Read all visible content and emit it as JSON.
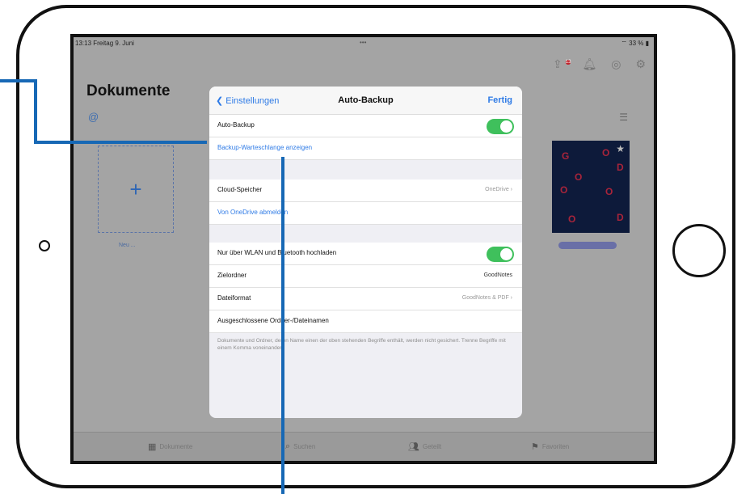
{
  "status": {
    "time": "13:13  Freitag 9. Juni",
    "dots": "•••",
    "battery": "⌔ 33 % ▮"
  },
  "toolbar": {
    "badge": "13"
  },
  "documents": {
    "title": "Dokumente",
    "new_label": "Neu ..."
  },
  "modal": {
    "back_label": "Einstellungen",
    "title": "Auto-Backup",
    "done_label": "Fertig",
    "rows": {
      "auto_backup": "Auto-Backup",
      "queue": "Backup-Warteschlange anzeigen",
      "cloud": "Cloud-Speicher",
      "cloud_value": "OneDrive",
      "signout": "Von OneDrive abmelden",
      "wifi": "Nur über WLAN und Bluetooth hochladen",
      "target": "Zielordner",
      "target_value": "GoodNotes",
      "format": "Dateiformat",
      "format_value": "GoodNotes & PDF",
      "excluded": "Ausgeschlossene Ordner-/Dateinamen"
    },
    "footer": "Dokumente und Ordner, deren Name einen der oben stehenden Begriffe enthält, werden nicht gesichert. Trenne Begriffe mit einem Komma voneinander."
  },
  "tabs": {
    "documents": "Dokumente",
    "search": "Suchen",
    "shared": "Geteilt",
    "favorites": "Favoriten"
  },
  "colors": {
    "accent": "#2f7be6",
    "toggle_on": "#3fc05c",
    "callout": "#1768b5"
  }
}
